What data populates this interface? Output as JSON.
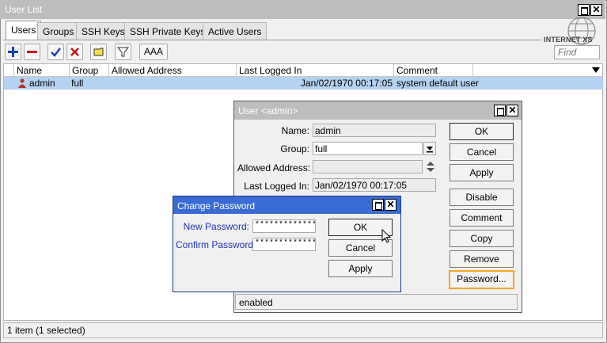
{
  "window": {
    "title": "User List"
  },
  "tabs": [
    "Users",
    "Groups",
    "SSH Keys",
    "SSH Private Keys",
    "Active Users"
  ],
  "toolbar": {
    "aaa_label": "AAA"
  },
  "brand": {
    "logo_text": "INTERNET XS"
  },
  "find": {
    "placeholder": "Find"
  },
  "table": {
    "columns": [
      "Name",
      "Group",
      "Allowed Address",
      "Last Logged In",
      "Comment"
    ],
    "rows": [
      {
        "name": "admin",
        "group": "full",
        "allowed_address": "",
        "last_logged_in": "Jan/02/1970 00:17:05",
        "comment": "system default user"
      }
    ]
  },
  "status": {
    "text": "1 item (1 selected)"
  },
  "user_dialog": {
    "title": "User <admin>",
    "labels": {
      "name": "Name:",
      "group": "Group:",
      "allowed_address": "Allowed Address:",
      "last_logged_in": "Last Logged In:"
    },
    "values": {
      "name": "admin",
      "group": "full",
      "allowed_address": "",
      "last_logged_in": "Jan/02/1970 00:17:05"
    },
    "buttons": {
      "ok": "OK",
      "cancel": "Cancel",
      "apply": "Apply",
      "disable": "Disable",
      "comment": "Comment",
      "copy": "Copy",
      "remove": "Remove",
      "password": "Password..."
    },
    "status": "enabled"
  },
  "password_dialog": {
    "title": "Change Password",
    "labels": {
      "new_password": "New Password:",
      "confirm_password": "Confirm Password:"
    },
    "values": {
      "new_password": "****************",
      "confirm_password": "****************"
    },
    "buttons": {
      "ok": "OK",
      "cancel": "Cancel",
      "apply": "Apply"
    }
  },
  "colors": {
    "selection": "#b5d2f0",
    "title_inactive": "#bdbdbd",
    "title_active": "#3a6bd5",
    "focus": "#f5a623",
    "label_blue": "#2233bb"
  }
}
